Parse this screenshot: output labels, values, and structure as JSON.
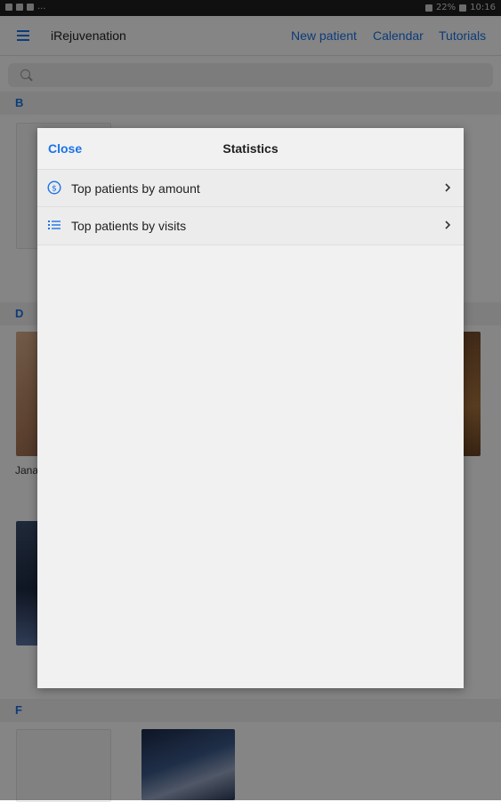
{
  "status_bar": {
    "left_more": "...",
    "battery": "22%",
    "time": "10:16"
  },
  "app_bar": {
    "title": "iRejuvenation",
    "links": [
      "New patient",
      "Calendar",
      "Tutorials"
    ]
  },
  "list": {
    "sections": [
      {
        "letter": "B"
      },
      {
        "letter": "D"
      },
      {
        "letter": "F"
      }
    ],
    "visible_name_fragment": "Jana"
  },
  "modal": {
    "close_label": "Close",
    "title": "Statistics",
    "items": [
      {
        "label": "Top patients by amount",
        "icon": "dollar-circle-icon"
      },
      {
        "label": "Top patients by visits",
        "icon": "list-icon"
      }
    ]
  },
  "colors": {
    "accent": "#1a73e8"
  }
}
